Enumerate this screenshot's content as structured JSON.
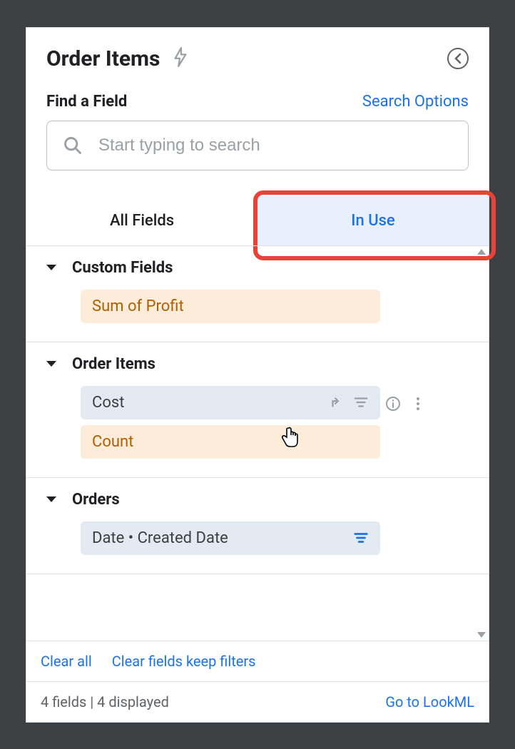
{
  "header": {
    "title": "Order Items"
  },
  "search": {
    "find_label": "Find a Field",
    "options_label": "Search Options",
    "placeholder": "Start typing to search"
  },
  "tabs": {
    "all": "All Fields",
    "in_use": "In Use"
  },
  "groups": [
    {
      "title": "Custom Fields",
      "fields": [
        {
          "label": "Sum of Profit",
          "style": "orange"
        }
      ]
    },
    {
      "title": "Order Items",
      "fields": [
        {
          "label": "Cost",
          "style": "blue",
          "hovered": true
        },
        {
          "label": "Count",
          "style": "orange"
        }
      ]
    },
    {
      "title": "Orders",
      "fields": [
        {
          "label": "Date • Created Date",
          "style": "blue",
          "filter_icon": true
        }
      ]
    }
  ],
  "bottom": {
    "clear_all": "Clear all",
    "clear_keep": "Clear fields keep filters"
  },
  "footer": {
    "status": "4 fields | 4 displayed",
    "lookml": "Go to LookML"
  }
}
